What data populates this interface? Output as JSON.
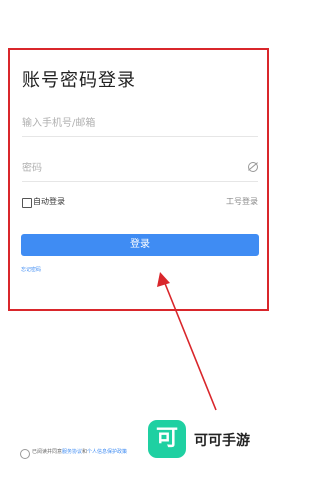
{
  "login": {
    "title": "账号密码登录",
    "phone_placeholder": "输入手机号/邮箱",
    "password_placeholder": "密码",
    "auto_login_label": "自动登录",
    "staff_login_label": "工号登录",
    "login_button_label": "登录",
    "forgot_password_label": "忘记密码"
  },
  "agreement": {
    "prefix": "已阅读并同意",
    "service_link": "服务协议",
    "and": "和",
    "privacy_link": "个人信息保护政策"
  },
  "brand": {
    "logo_char": "可",
    "name": "可可手游"
  },
  "colors": {
    "highlight": "#d9262b",
    "accent": "#3f8cf3",
    "brand": "#1fd0a2"
  },
  "icons": {
    "password_visibility": "eye-off-icon"
  }
}
